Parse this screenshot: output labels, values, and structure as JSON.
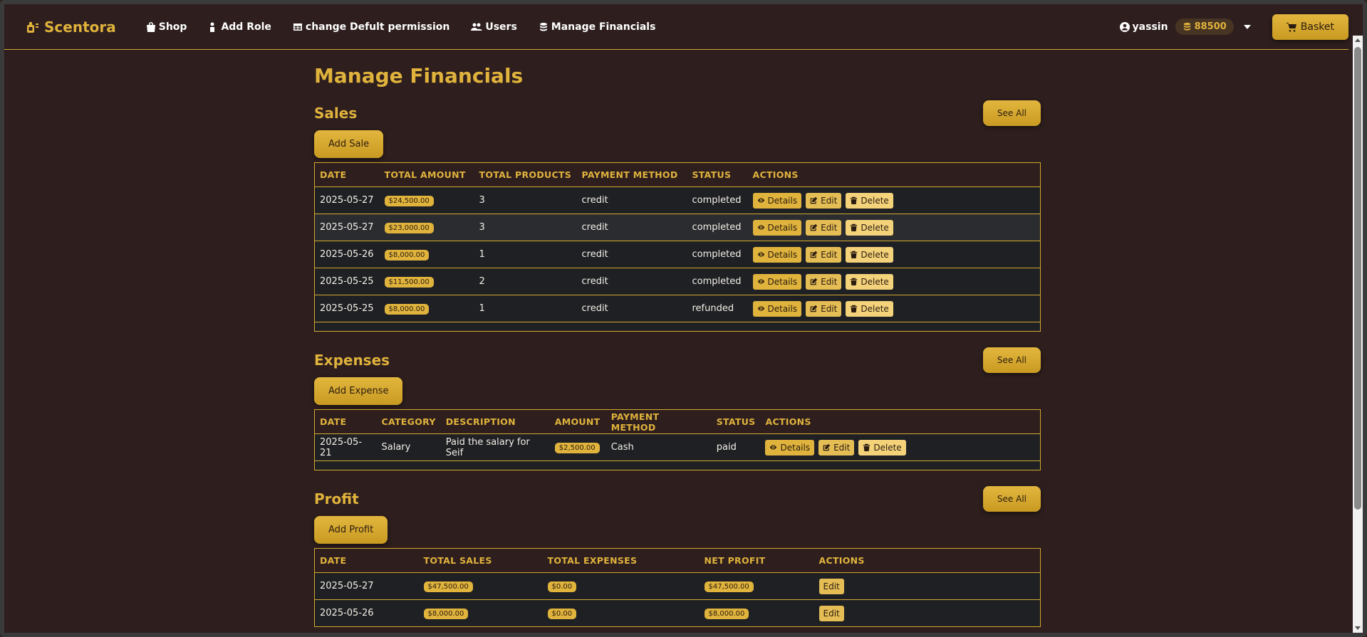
{
  "nav": {
    "brand": "Scentora",
    "links": [
      "Shop",
      "Add Role",
      "change Defult permission",
      "Users",
      "Manage Financials"
    ],
    "user": "yassin",
    "coins": "88500",
    "basket": "Basket"
  },
  "page_title": "Manage Financials",
  "see_all": "See All",
  "actions": {
    "details": "Details",
    "edit": "Edit",
    "delete": "Delete"
  },
  "sales": {
    "title": "Sales",
    "add_label": "Add Sale",
    "headers": [
      "DATE",
      "TOTAL AMOUNT",
      "TOTAL PRODUCTS",
      "PAYMENT METHOD",
      "STATUS",
      "ACTIONS"
    ],
    "rows": [
      {
        "date": "2025-05-27",
        "amount": "$24,500.00",
        "products": "3",
        "method": "credit",
        "status": "completed"
      },
      {
        "date": "2025-05-27",
        "amount": "$23,000.00",
        "products": "3",
        "method": "credit",
        "status": "completed"
      },
      {
        "date": "2025-05-26",
        "amount": "$8,000.00",
        "products": "1",
        "method": "credit",
        "status": "completed"
      },
      {
        "date": "2025-05-25",
        "amount": "$11,500.00",
        "products": "2",
        "method": "credit",
        "status": "completed"
      },
      {
        "date": "2025-05-25",
        "amount": "$8,000.00",
        "products": "1",
        "method": "credit",
        "status": "refunded"
      }
    ]
  },
  "expenses": {
    "title": "Expenses",
    "add_label": "Add Expense",
    "headers": [
      "DATE",
      "CATEGORY",
      "DESCRIPTION",
      "AMOUNT",
      "PAYMENT METHOD",
      "STATUS",
      "ACTIONS"
    ],
    "rows": [
      {
        "date": "2025-05-21",
        "category": "Salary",
        "description": "Paid the salary for Seif",
        "amount": "$2,500.00",
        "method": "Cash",
        "status": "paid"
      }
    ]
  },
  "profit": {
    "title": "Profit",
    "add_label": "Add Profit",
    "headers": [
      "DATE",
      "TOTAL SALES",
      "TOTAL EXPENSES",
      "NET PROFIT",
      "ACTIONS"
    ],
    "rows": [
      {
        "date": "2025-05-27",
        "sales": "$47,500.00",
        "expenses": "$0.00",
        "net": "$47,500.00"
      },
      {
        "date": "2025-05-26",
        "sales": "$8,000.00",
        "expenses": "$0.00",
        "net": "$8,000.00"
      }
    ]
  }
}
